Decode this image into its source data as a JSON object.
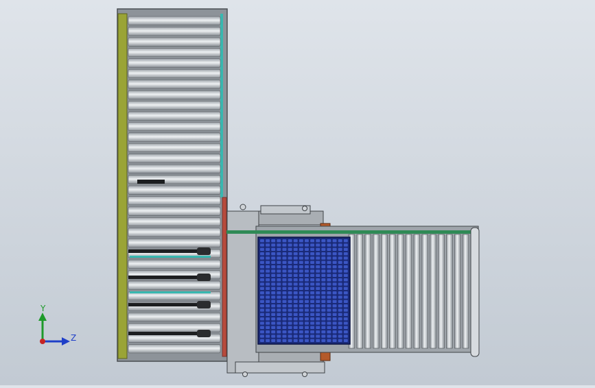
{
  "triad": {
    "y_label": "Y",
    "z_label": "Z"
  },
  "colors": {
    "background_top": "#dfe4ea",
    "background_bottom": "#c2cad3",
    "frame": "#6a6e72",
    "roller": "#b9bec4",
    "roller_highlight": "#e6e9ec",
    "olive_rail": "#9aa436",
    "cyan_rail": "#38b8b0",
    "green_rail": "#2f8a56",
    "red_rail": "#b74a3c",
    "pallet_blue": "#23389a",
    "orange_block": "#b45a2a"
  },
  "counts": {
    "vertical_conveyor_rollers": 32,
    "horizontal_conveyor_rollers": 15,
    "pallet_columns": 16,
    "pallet_rows": 24
  }
}
